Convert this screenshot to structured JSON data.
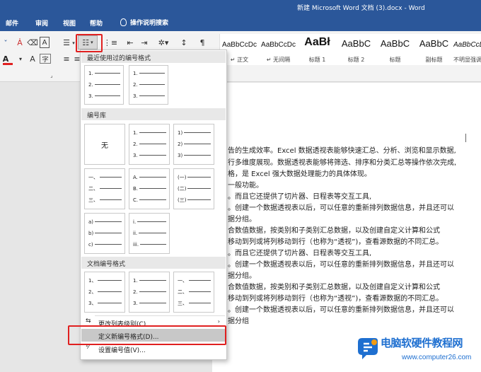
{
  "window": {
    "title": "新建 Microsoft Word 文档 (3).docx  -  Word"
  },
  "tabs": [
    {
      "label": "邮件"
    },
    {
      "label": "审阅"
    },
    {
      "label": "视图"
    },
    {
      "label": "帮助"
    }
  ],
  "tell_me": {
    "label": "操作说明搜索"
  },
  "styles": [
    {
      "preview": "AaBbCcDc",
      "label": "↵ 正文"
    },
    {
      "preview": "AaBbCcDc",
      "label": "↵ 无间隔"
    },
    {
      "preview": "AaBł",
      "label": "标题 1"
    },
    {
      "preview": "AaBbC",
      "label": "标题 2"
    },
    {
      "preview": "AaBbC",
      "label": "标题"
    },
    {
      "preview": "AaBbC",
      "label": "副标题"
    },
    {
      "preview": "AaBbCcDc",
      "label": "不明显强调"
    }
  ],
  "document": {
    "lines": [
      "告的生成效率。Excel 数据透视表能够快速汇总、分析、浏览和显示数据,",
      "行多维度展现。数据透视表能够将筛选、排序和分类汇总等操作依次完成,",
      "格，是 Excel 强大数据处理能力的具体体现。",
      "一般功能。",
      "。而且它还提供了切片器、日程表等交互工具,",
      "。创建一个数据透视表以后，可以任意的重新排列数据信息，并且还可以",
      "据分组。",
      "合数值数据，按类别和子类别汇总数据，以及创建自定义计算和公式",
      "移动到列或将列移动到行（也称为“透视”)，查看源数据的不同汇总。",
      "。而且它还提供了切片器、日程表等交互工具,",
      "。创建一个数据透视表以后，可以任意的重新排列数据信息，并且还可以",
      "据分组。",
      "合数值数据，按类别和子类别汇总数据，以及创建自定义计算和公式",
      "移动到列或将列移动到行（也称为“透视”)，查看源数据的不同汇总。",
      "。创建一个数据透视表以后，可以任意的重新排列数据信息，并且还可以",
      "据分组"
    ]
  },
  "numbering_menu": {
    "recent_header": "最近使用过的编号格式",
    "library_header": "编号库",
    "document_header": "文档编号格式",
    "none_label": "无",
    "recent_tiles": [
      [
        "1.",
        "2.",
        "3."
      ],
      [
        "1.",
        "2.",
        "3."
      ]
    ],
    "library_tiles": [
      [
        "1.",
        "2.",
        "3."
      ],
      [
        "1)",
        "2)",
        "3)"
      ],
      [
        "一、",
        "二、",
        "三、"
      ],
      [
        "A.",
        "B.",
        "C."
      ],
      [
        "(一)",
        "(二)",
        "(三)"
      ],
      [
        "a)",
        "b)",
        "c)"
      ],
      [
        "i.",
        "ii.",
        "iii."
      ]
    ],
    "document_tiles": [
      [
        "1、",
        "2、",
        "3、"
      ],
      [
        "1.",
        "2.",
        "3."
      ],
      [
        "一、",
        "二、",
        "三、"
      ]
    ],
    "change_level": "更改列表级别(C)",
    "define_new": "定义新编号格式(D)...",
    "set_value": "设置编号值(V)..."
  },
  "watermark": {
    "title": "电脑软硬件教程网",
    "url": "www.computer26.com"
  },
  "colors": {
    "title_bar": "#2b579a",
    "highlight_box": "#e02020",
    "watermark": "#1e6fd0"
  }
}
